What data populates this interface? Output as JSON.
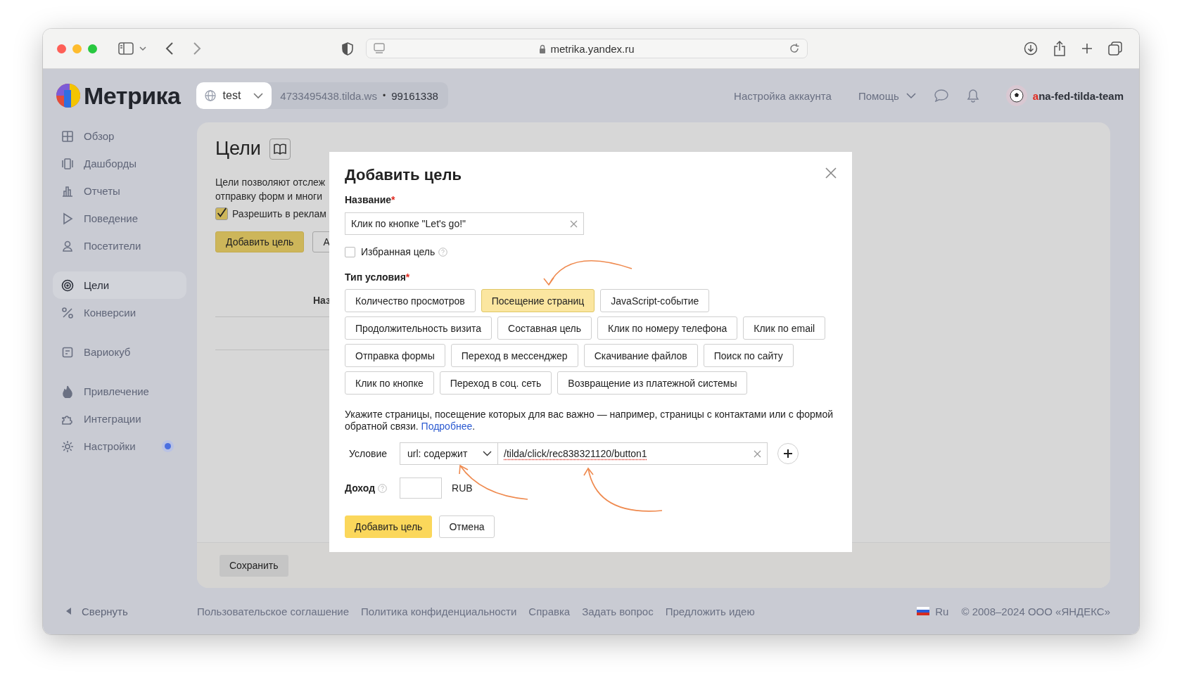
{
  "browser": {
    "url": "metrika.yandex.ru"
  },
  "header": {
    "logo": "Метрика",
    "counter": {
      "name": "test",
      "domain": "4733495438.tilda.ws",
      "separator": "•",
      "id": "99161338"
    },
    "account_settings": "Настройка аккаунта",
    "help": "Помощь",
    "login": "ana-fed-tilda-team"
  },
  "sidebar": {
    "groups": [
      {
        "items": [
          {
            "label": "Обзор",
            "selected": false,
            "notification": false
          },
          {
            "label": "Дашборды",
            "selected": false,
            "notification": false
          },
          {
            "label": "Отчеты",
            "selected": false,
            "notification": false
          },
          {
            "label": "Поведение",
            "selected": false,
            "notification": false
          },
          {
            "label": "Посетители",
            "selected": false,
            "notification": false
          }
        ]
      },
      {
        "items": [
          {
            "label": "Цели",
            "selected": true,
            "notification": false
          },
          {
            "label": "Конверсии",
            "selected": false,
            "notification": false
          }
        ]
      },
      {
        "items": [
          {
            "label": "Вариокуб",
            "selected": false,
            "notification": false
          }
        ]
      },
      {
        "items": [
          {
            "label": "Привлечение",
            "selected": false,
            "notification": false
          },
          {
            "label": "Интеграции",
            "selected": false,
            "notification": false
          },
          {
            "label": "Настройки",
            "selected": false,
            "notification": true
          }
        ]
      }
    ],
    "collapse": "Свернуть"
  },
  "page": {
    "title": "Цели",
    "description_lines": [
      "Цели позволяют отслеж",
      "отправку форм и многи"
    ],
    "ad_checkbox": {
      "label": "Разрешить в реклам",
      "checked": true
    },
    "add_button": "Добавить цель",
    "second_button": "А",
    "column_1": "Наз",
    "save_button": "Сохранить"
  },
  "modal": {
    "title": "Добавить цель",
    "name_label": {
      "text": "Название",
      "mark": "*"
    },
    "name_value": "Клик по кнопке \"Let's go!\"",
    "favorite": {
      "label": "Избранная цель",
      "checked": false
    },
    "type_label": {
      "text": "Тип условия",
      "mark": "*"
    },
    "type_rows": [
      [
        {
          "label": "Количество просмотров",
          "selected": false
        },
        {
          "label": "Посещение страниц",
          "selected": true
        },
        {
          "label": "JavaScript-событие",
          "selected": false
        }
      ],
      [
        {
          "label": "Продолжительность визита",
          "selected": false
        },
        {
          "label": "Составная цель",
          "selected": false
        },
        {
          "label": "Клик по номеру телефона",
          "selected": false
        },
        {
          "label": "Клик по email",
          "selected": false
        }
      ],
      [
        {
          "label": "Отправка формы",
          "selected": false
        },
        {
          "label": "Переход в мессенджер",
          "selected": false
        },
        {
          "label": "Скачивание файлов",
          "selected": false
        },
        {
          "label": "Поиск по сайту",
          "selected": false
        }
      ],
      [
        {
          "label": "Клик по кнопке",
          "selected": false
        },
        {
          "label": "Переход в соц. сеть",
          "selected": false
        },
        {
          "label": "Возвращение из платежной системы",
          "selected": false
        }
      ]
    ],
    "hint_text": "Укажите страницы, посещение которых для вас важно — например, страницы с контактами или с формой обратной связи.",
    "hint_link": "Подробнее",
    "hint_end": ".",
    "condition": {
      "label": "Условие",
      "operator": "url: содержит",
      "value": "/tilda/click/rec838321120/button1"
    },
    "income": {
      "label": "Доход",
      "currency": "RUB"
    },
    "submit": "Добавить цель",
    "cancel": "Отмена"
  },
  "footer": {
    "links": [
      "Пользовательское соглашение",
      "Политика конфиденциальности",
      "Справка",
      "Задать вопрос",
      "Предложить идею"
    ],
    "language": "Ru",
    "copyright": "© 2008–2024 ООО «ЯНДЕКС»"
  }
}
